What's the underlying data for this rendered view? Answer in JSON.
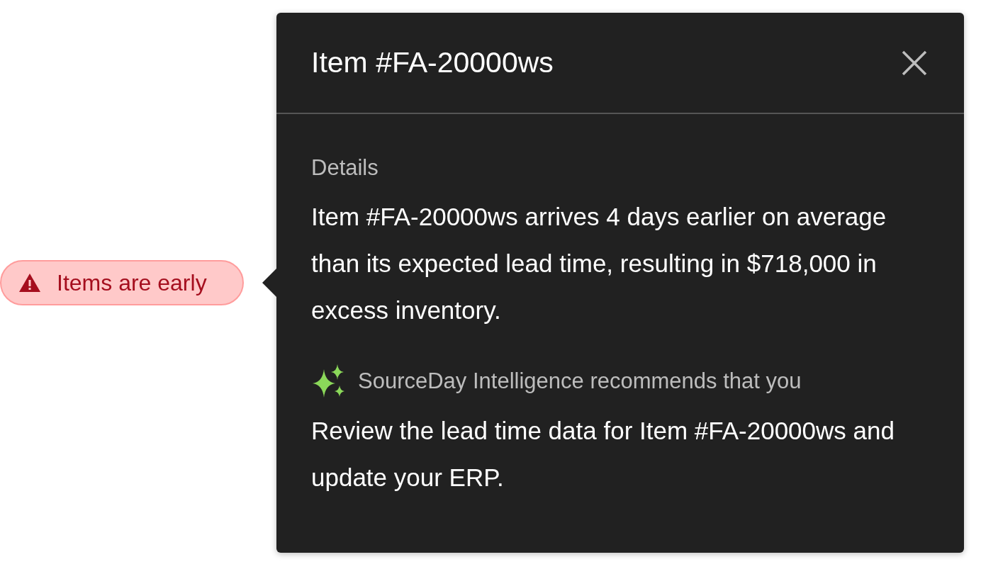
{
  "badge": {
    "label": "Items are early"
  },
  "popover": {
    "title": "Item #FA-20000ws",
    "section_label": "Details",
    "details": "Item #FA-20000ws arrives 4 days earlier on average than its expected lead time, resulting in $718,000 in excess inventory.",
    "recommendation_label": "SourceDay Intelligence recommends that you",
    "recommendation": "Review the lead time data for Item #FA-20000ws and update your ERP."
  }
}
